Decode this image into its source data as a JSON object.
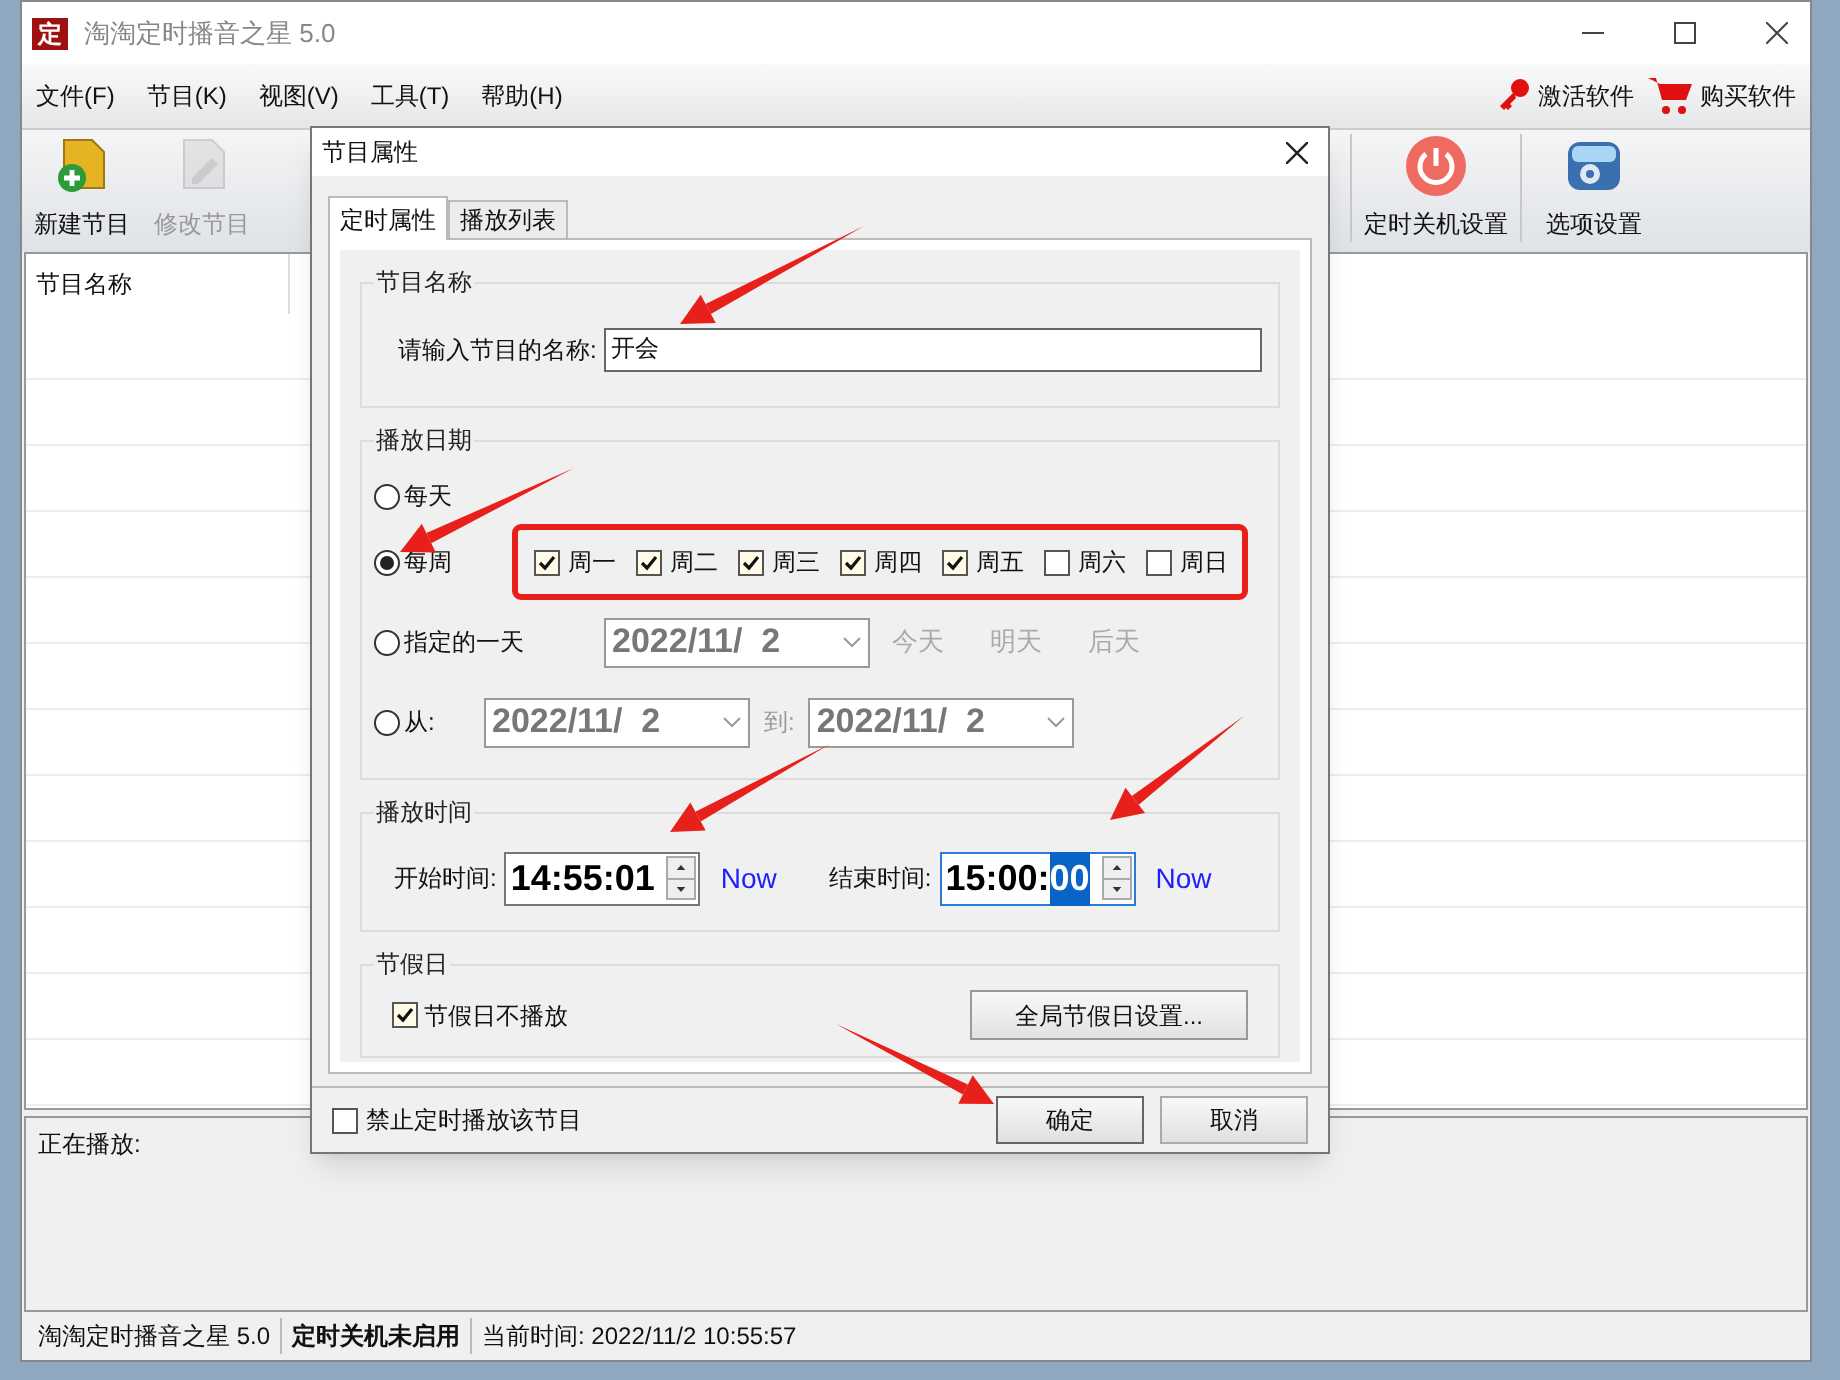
{
  "window": {
    "title": "淘淘定时播音之星 5.0",
    "logo": "定"
  },
  "menu": {
    "items": [
      "文件(F)",
      "节目(K)",
      "视图(V)",
      "工具(T)",
      "帮助(H)"
    ],
    "links": [
      {
        "kind": "key",
        "label": "激活软件"
      },
      {
        "kind": "cart",
        "label": "购买软件"
      }
    ]
  },
  "toolbar": [
    {
      "kind": "new",
      "label": "新建节目",
      "disabled": false
    },
    {
      "kind": "edit",
      "label": "修改节目",
      "disabled": true
    },
    {
      "kind": "power",
      "label": "定时关机设置",
      "disabled": false
    },
    {
      "kind": "options",
      "label": "选项设置",
      "disabled": false
    }
  ],
  "program_list": {
    "columns": [
      "节目名称"
    ]
  },
  "now_playing": {
    "label": "正在播放:"
  },
  "status_bar": [
    {
      "text": "淘淘定时播音之星 5.0",
      "bold": false
    },
    {
      "text": "定时关机未启用",
      "bold": true
    },
    {
      "text": "当前时间: 2022/11/2 10:55:57",
      "bold": false
    }
  ],
  "dialog": {
    "title": "节目属性",
    "tabs": [
      {
        "label": "定时属性",
        "selected": true
      },
      {
        "label": "播放列表",
        "selected": false
      }
    ],
    "name_group": {
      "title": "节目名称",
      "label": "请输入节目的名称:",
      "value": "开会"
    },
    "date_group": {
      "title": "播放日期",
      "options": [
        {
          "kind": "daily",
          "label": "每天",
          "selected": false
        },
        {
          "kind": "weekly",
          "label": "每周",
          "selected": true
        },
        {
          "kind": "date",
          "label": "指定的一天",
          "selected": false
        },
        {
          "kind": "range",
          "label": "从:",
          "selected": false
        }
      ],
      "weekdays": [
        {
          "label": "周一",
          "checked": true
        },
        {
          "label": "周二",
          "checked": true
        },
        {
          "label": "周三",
          "checked": true
        },
        {
          "label": "周四",
          "checked": true
        },
        {
          "label": "周五",
          "checked": true
        },
        {
          "label": "周六",
          "checked": false
        },
        {
          "label": "周日",
          "checked": false
        }
      ],
      "date": "2022/11/  2",
      "quick_days": [
        "今天",
        "明天",
        "后天"
      ],
      "range_from": "2022/11/  2",
      "range_to_label": "到:",
      "range_to": "2022/11/  2"
    },
    "time_group": {
      "title": "播放时间",
      "start": {
        "label": "开始时间:",
        "value": "14:55:01",
        "focused": false,
        "now": "Now"
      },
      "end": {
        "label": "结束时间:",
        "value": "15:00:",
        "selected_part": "00",
        "focused": true,
        "now": "Now"
      }
    },
    "holiday_group": {
      "title": "节假日",
      "checkbox": {
        "label": "节假日不播放",
        "checked": true
      },
      "button": "全局节假日设置..."
    },
    "disable_checkbox": {
      "label": "禁止定时播放该节目",
      "checked": false
    },
    "buttons": [
      {
        "label": "确定",
        "default": true
      },
      {
        "label": "取消",
        "default": false
      }
    ]
  }
}
